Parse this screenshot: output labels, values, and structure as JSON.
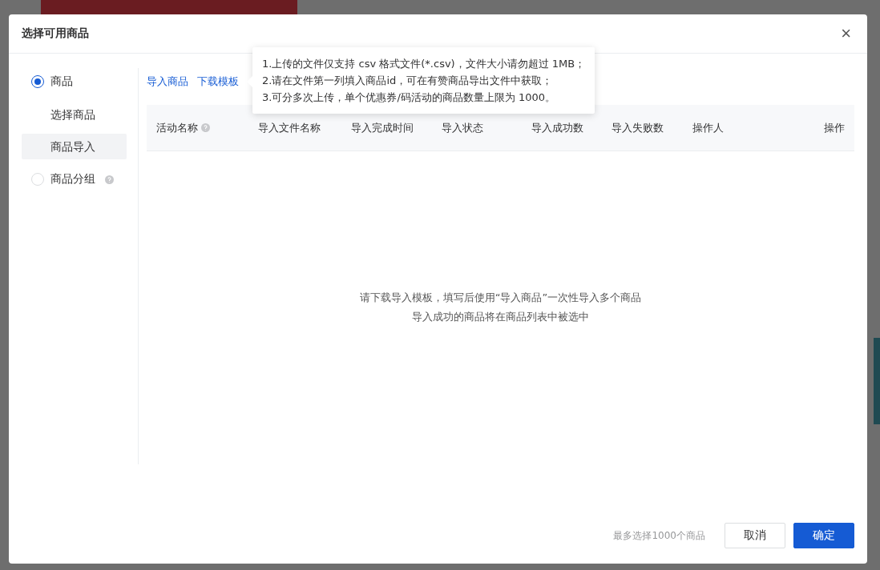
{
  "dialog": {
    "title": "选择可用商品",
    "close": "×"
  },
  "sidebar": [
    {
      "kind": "radio",
      "label": "商品",
      "selected": true,
      "help": false
    },
    {
      "kind": "sub",
      "label": "选择商品",
      "selected": false
    },
    {
      "kind": "sub",
      "label": "商品导入",
      "selected": true
    },
    {
      "kind": "radio",
      "label": "商品分组",
      "selected": false,
      "help": true
    }
  ],
  "links": [
    "导入商品",
    "下载模板"
  ],
  "tooltip": [
    "1.上传的文件仅支持 csv 格式文件(*.csv)，文件大小请勿超过 1MB；",
    "2.请在文件第一列填入商品id，可在有赞商品导出文件中获取；",
    "3.可分多次上传，单个优惠券/码活动的商品数量上限为 1000。"
  ],
  "table": {
    "columns": [
      {
        "label": "活动名称",
        "help": true
      },
      {
        "label": "导入文件名称",
        "help": false
      },
      {
        "label": "导入完成时间",
        "help": false
      },
      {
        "label": "导入状态",
        "help": false
      },
      {
        "label": "导入成功数",
        "help": false
      },
      {
        "label": "导入失败数",
        "help": false
      },
      {
        "label": "操作人",
        "help": false
      },
      {
        "label": "操作",
        "help": false
      }
    ],
    "empty": [
      "请下载导入模板，填写后使用“导入商品”一次性导入多个商品",
      "导入成功的商品将在商品列表中被选中"
    ]
  },
  "footer": {
    "hint": "最多选择1000个商品",
    "cancel": "取消",
    "ok": "确定"
  }
}
